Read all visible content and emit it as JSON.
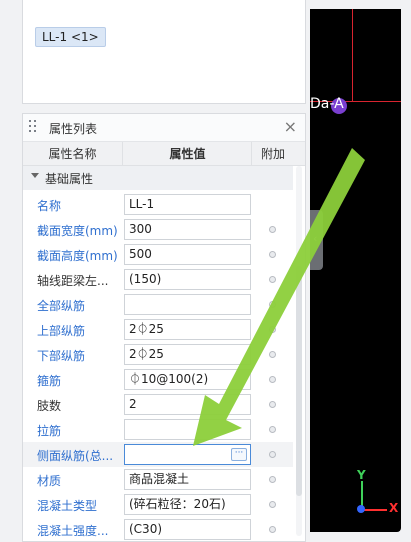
{
  "top_list": {
    "selected_item": "LL-1 <1>"
  },
  "panel": {
    "title": "属性列表",
    "close_glyph": "×",
    "columns": {
      "name": "属性名称",
      "value": "属性值",
      "extra": "附加"
    },
    "group": "基础属性",
    "rows": [
      {
        "name": "名称",
        "value": "LL-1",
        "color": "blue",
        "dot": false
      },
      {
        "name": "截面宽度(mm)",
        "value": "300",
        "color": "blue",
        "dot": true
      },
      {
        "name": "截面高度(mm)",
        "value": "500",
        "color": "blue",
        "dot": true
      },
      {
        "name": "轴线距梁左...",
        "value": "(150)",
        "color": "black",
        "dot": true
      },
      {
        "name": "全部纵筋",
        "value": "",
        "color": "blue",
        "dot": true
      },
      {
        "name": "上部纵筋",
        "value": "2⏀25",
        "color": "blue",
        "dot": true
      },
      {
        "name": "下部纵筋",
        "value": "2⏀25",
        "color": "blue",
        "dot": true
      },
      {
        "name": "箍筋",
        "value": "⏀10@100(2)",
        "color": "blue",
        "dot": true
      },
      {
        "name": "肢数",
        "value": "2",
        "color": "black",
        "dot": true
      },
      {
        "name": "拉筋",
        "value": "",
        "color": "blue",
        "dot": true
      },
      {
        "name": "侧面纵筋(总...",
        "value": "",
        "color": "blue",
        "dot": true,
        "active": true,
        "button": "···"
      },
      {
        "name": "材质",
        "value": "商品混凝土",
        "color": "blue",
        "dot": true
      },
      {
        "name": "混凝土类型",
        "value": "(碎石粒径：20石)",
        "color": "blue",
        "dot": true
      },
      {
        "name": "混凝土强度...",
        "value": "(C30)",
        "color": "blue",
        "dot": true
      }
    ]
  },
  "canvas": {
    "axis_label": "Da-A",
    "ucs_y": "Y",
    "ucs_x": "X",
    "handle_glyph": "‹",
    "colors": {
      "grid_line": "#d9242f",
      "axis_marker": "#7a3fd0",
      "ucs_y": "#3fd15a",
      "ucs_x": "#ff3030",
      "annotation_arrow": "#8ccf3a"
    }
  }
}
